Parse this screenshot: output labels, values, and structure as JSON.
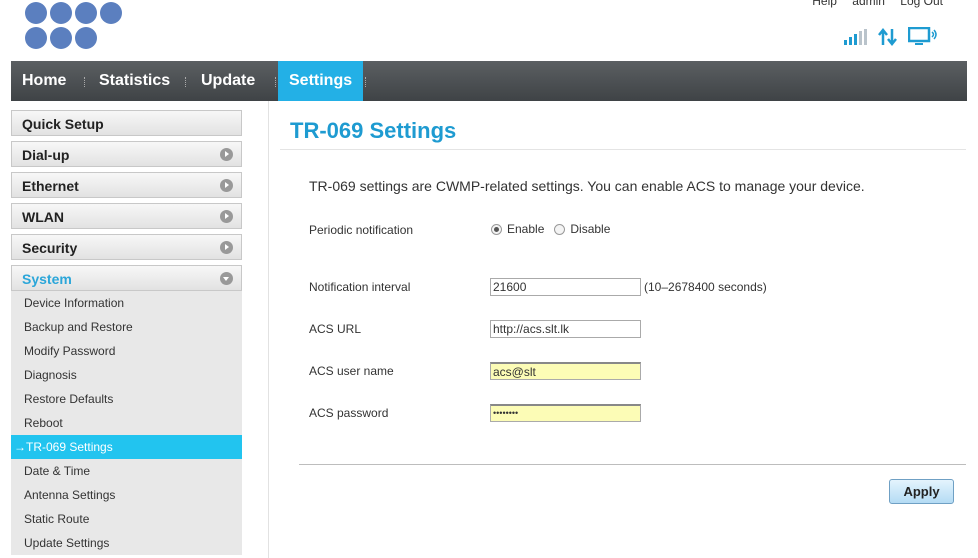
{
  "header": {
    "links": [
      "Help",
      "admin",
      "Log Out"
    ],
    "logo_icon": "huawei-dots-logo",
    "status_icons": [
      "signal-strength-icon",
      "data-transfer-icon",
      "computer-connected-icon"
    ]
  },
  "nav": {
    "items": [
      "Home",
      "Statistics",
      "Update",
      "Settings"
    ],
    "active": "Settings"
  },
  "sidebar": {
    "groups": [
      "Quick Setup",
      "Dial-up",
      "Ethernet",
      "WLAN",
      "Security",
      "System"
    ],
    "open_group": "System",
    "items": [
      "Device Information",
      "Backup and Restore",
      "Modify Password",
      "Diagnosis",
      "Restore Defaults",
      "Reboot",
      "TR-069 Settings",
      "Date & Time",
      "Antenna Settings",
      "Static Route",
      "Update Settings"
    ],
    "active_item": "TR-069 Settings",
    "active_prefix": "→"
  },
  "main": {
    "title": "TR-069 Settings",
    "description": "TR-069 settings are CWMP-related settings. You can enable ACS to manage your device.",
    "periodic_label": "Periodic notification",
    "enable_label": "Enable",
    "disable_label": "Disable",
    "periodic_value": "Enable",
    "interval_label": "Notification interval",
    "interval_value": "21600",
    "interval_hint": "(10–2678400 seconds)",
    "acs_url_label": "ACS URL",
    "acs_url_value": "http://acs.slt.lk",
    "acs_user_label": "ACS user name",
    "acs_user_value": "acs@slt",
    "acs_password_label": "ACS password",
    "acs_password_value": "••••••••",
    "apply_label": "Apply"
  },
  "colors": {
    "accent": "#23b0e6",
    "title": "#1e9bd1",
    "nav_bg": "#4a4e51",
    "active_sidebar": "#22c4ef",
    "logo": "#5b7fbf",
    "autofill": "#fcfcb6"
  }
}
